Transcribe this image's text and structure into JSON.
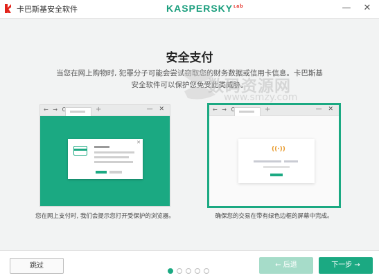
{
  "titlebar": {
    "app_title": "卡巴斯基安全软件",
    "brand": "KASPERSKY",
    "brand_mark": "ʟab",
    "minimize": "—",
    "close": "✕"
  },
  "main": {
    "heading": "安全支付",
    "description": "当您在网上购物时, 犯罪分子可能会尝试窃取您的财务数据或信用卡信息。卡巴斯基安全软件可以保护您免受此类威胁。"
  },
  "watermark": {
    "text": "数码资源网",
    "url": "www.smzy.com"
  },
  "cards": {
    "browser": {
      "nav": "← → C",
      "plus": "+",
      "ctrl": "— ✕",
      "popup_close": "✕",
      "secure_badge": "((·))"
    },
    "left_caption": "您在网上支付时, 我们会提示您打开受保护的浏览器。",
    "right_caption": "确保您的交易在带有绿色边框的屏幕中完成。"
  },
  "footer": {
    "skip_label": "跳过",
    "back_label": "← 后退",
    "next_label": "下一步 →",
    "pages": 5,
    "active_page": 1
  },
  "colors": {
    "accent": "#1ba982",
    "accent_disabled": "#a6dcc9",
    "brand_red": "#e2231a"
  }
}
